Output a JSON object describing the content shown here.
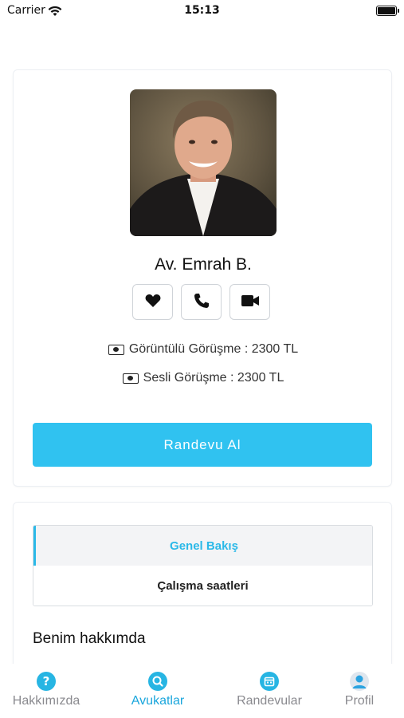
{
  "status_bar": {
    "carrier": "Carrier",
    "time": "15:13"
  },
  "lawyer": {
    "name": "Av. Emrah B.",
    "video_price": "Görüntülü Görüşme : 2300 TL",
    "audio_price": "Sesli Görüşme : 2300 TL",
    "appointment_label": "Randevu Al"
  },
  "tabs": {
    "overview": "Genel Bakış",
    "hours": "Çalışma saatleri"
  },
  "about": {
    "title": "Benim hakkımda"
  },
  "nav": [
    {
      "label": "Hakkımızda",
      "icon": "question-icon"
    },
    {
      "label": "Avukatlar",
      "icon": "search-icon"
    },
    {
      "label": "Randevular",
      "icon": "calendar-icon"
    },
    {
      "label": "Profil",
      "icon": "person-icon"
    }
  ],
  "colors": {
    "accent": "#30c2f0",
    "active_tab": "#2bb9e8",
    "nav_active": "#1aa6dc"
  }
}
